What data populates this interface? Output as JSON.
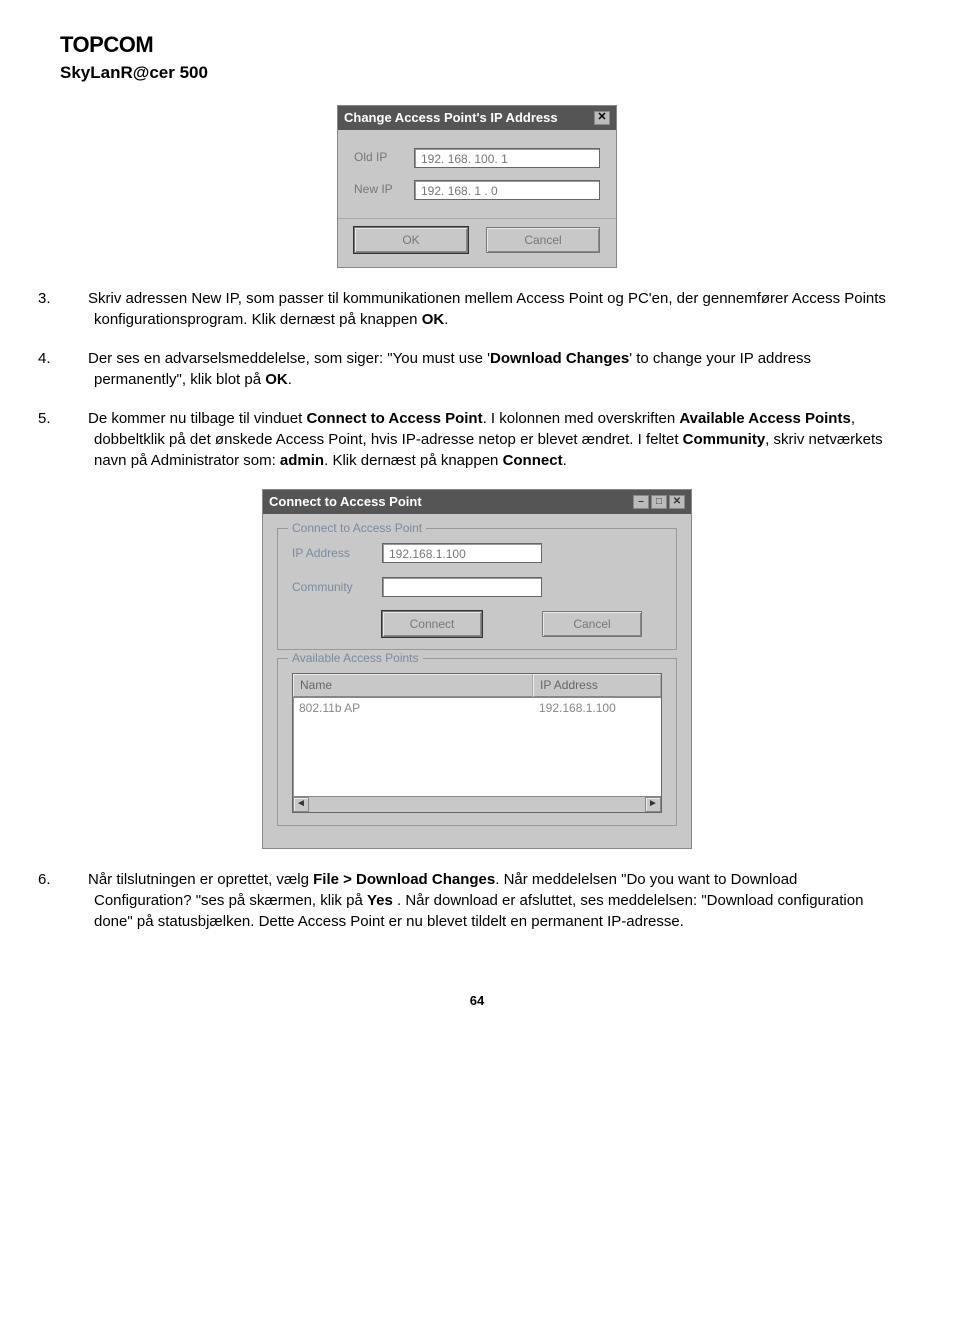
{
  "brand": {
    "top": "TOPCOM",
    "sub": "SkyLanR@cer 500"
  },
  "dialog1": {
    "title": "Change Access Point's IP Address",
    "labels": {
      "old": "Old IP",
      "new": "New IP"
    },
    "values": {
      "old": "192. 168. 100.  1",
      "new": "192. 168.  1 .  0"
    },
    "buttons": {
      "ok": "OK",
      "cancel": "Cancel"
    }
  },
  "steps": {
    "s3": {
      "num": "3.",
      "text_a": "Skriv adressen New IP, som passer til kommunikationen mellem Access Point og PC'en, der gennemfører Access Points konfigurationsprogram. Klik dernæst på knappen ",
      "b1": "OK",
      "text_b": "."
    },
    "s4": {
      "num": "4.",
      "text_a": "Der ses en advarselsmeddelelse, som siger: \"You must use '",
      "b1": "Download Changes",
      "text_b": "' to change your IP address permanently\", klik blot på ",
      "b2": "OK",
      "text_c": "."
    },
    "s5": {
      "num": "5.",
      "text_a": "De kommer nu tilbage til vinduet ",
      "b1": "Connect to Access Point",
      "text_b": ". I kolonnen med overskriften ",
      "b2": "Available Access Points",
      "text_c": ", dobbeltklik på det ønskede Access Point, hvis IP-adresse netop er blevet ændret. I feltet ",
      "b3": "Community",
      "text_d": ", skriv netværkets navn på Administrator som: ",
      "b4": "admin",
      "text_e": ". Klik dernæst på knappen ",
      "b5": "Connect",
      "text_f": "."
    },
    "s6": {
      "num": "6.",
      "text_a": "Når tilslutningen er oprettet, vælg ",
      "b1": "File > Download Changes",
      "text_b": ". Når meddelelsen \"Do you want to Download Configuration? \"ses på skærmen, klik på ",
      "b2": "Yes",
      "text_c": " . Når download er afsluttet, ses meddelelsen: \"Download configuration done\" på statusbjælken. Dette Access Point er nu blevet tildelt en permanent IP-adresse."
    }
  },
  "dialog2": {
    "title": "Connect to Access Point",
    "group1": {
      "legend": "Connect to Access Point",
      "ip_label": "IP Address",
      "ip_value": "192.168.1.100",
      "comm_label": "Community",
      "comm_value": "",
      "connect": "Connect",
      "cancel": "Cancel"
    },
    "group2": {
      "legend": "Available Access Points",
      "col_name": "Name",
      "col_ip": "IP Address",
      "row_name": "802.11b AP",
      "row_ip": "192.168.1.100"
    }
  },
  "icons": {
    "close": "✕",
    "min": "–",
    "max": "□",
    "left": "◄",
    "right": "►"
  },
  "footer": "64"
}
